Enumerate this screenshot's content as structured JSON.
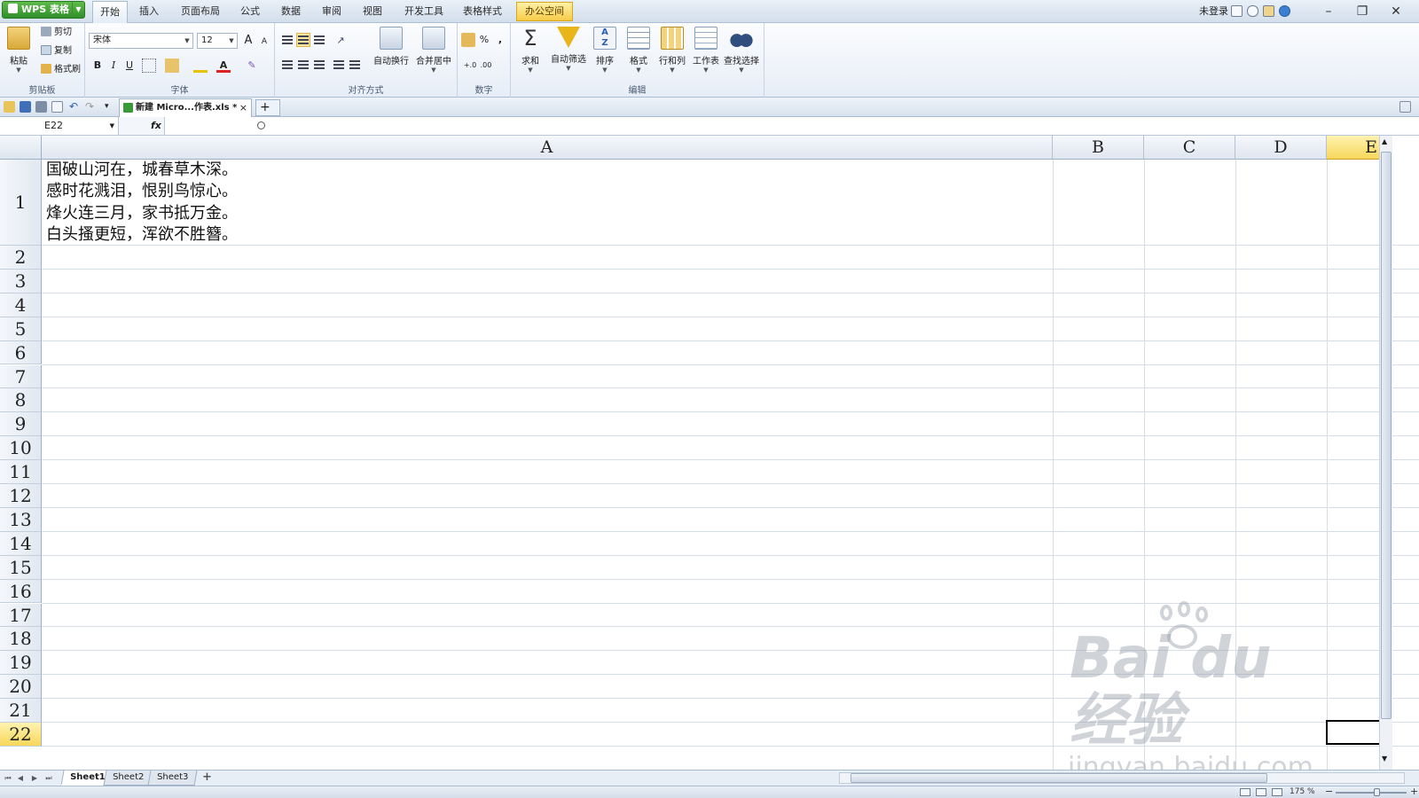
{
  "app": {
    "name": "WPS 表格"
  },
  "menu": {
    "tabs": [
      "开始",
      "插入",
      "页面布局",
      "公式",
      "数据",
      "审阅",
      "视图",
      "开发工具",
      "表格样式",
      "办公空间"
    ],
    "active": "开始",
    "login": "未登录"
  },
  "ribbon": {
    "clipboard": {
      "paste": "粘贴",
      "cut": "剪切",
      "copy": "复制",
      "format_painter": "格式刷",
      "label": "剪贴板"
    },
    "font": {
      "name": "宋体",
      "size": "12",
      "bold": "B",
      "italic": "I",
      "underline": "U",
      "grow": "A",
      "shrink": "A",
      "color_glyph": "A",
      "label": "字体"
    },
    "alignment": {
      "wrap": "自动换行",
      "merge": "合并居中",
      "label": "对齐方式"
    },
    "number": {
      "percent": "%",
      "comma": ",",
      "label": "数字"
    },
    "editing": {
      "sum": "求和",
      "autofilter": "自动筛选",
      "sort": "排序",
      "format": "格式",
      "rowcol": "行和列",
      "worksheet": "工作表",
      "find": "查找选择",
      "label": "编辑"
    }
  },
  "document": {
    "tab_title": "新建 Micro...作表.xls *",
    "close": "×",
    "new_tab": "+"
  },
  "formula": {
    "name_box": "E22",
    "fx": "fx",
    "value": ""
  },
  "grid": {
    "columns": [
      "A",
      "B",
      "C",
      "D",
      "E"
    ],
    "selected_column": "E",
    "rows": [
      "1",
      "2",
      "3",
      "4",
      "5",
      "6",
      "7",
      "8",
      "9",
      "10",
      "11",
      "12",
      "13",
      "14",
      "15",
      "16",
      "17",
      "18",
      "19",
      "20",
      "21",
      "22"
    ],
    "selected_row": "22",
    "cell_a1": [
      "国破山河在，城春草木深。",
      "感时花溅泪，恨别鸟惊心。",
      "烽火连三月，家书抵万金。",
      "白头搔更短，浑欲不胜簪。"
    ]
  },
  "sheets": {
    "tabs": [
      "Sheet1",
      "Sheet2",
      "Sheet3"
    ],
    "active": "Sheet1",
    "add": "+"
  },
  "status": {
    "zoom": "175 %",
    "zoom_minus": "−",
    "zoom_plus": "+"
  },
  "watermark": {
    "logo": "Bai du 经验",
    "url": "jingyan.baidu.com"
  },
  "colors": {
    "accent": "#f7d75a",
    "brand": "#2f8f2a",
    "office_tab": "#f6cc48"
  }
}
